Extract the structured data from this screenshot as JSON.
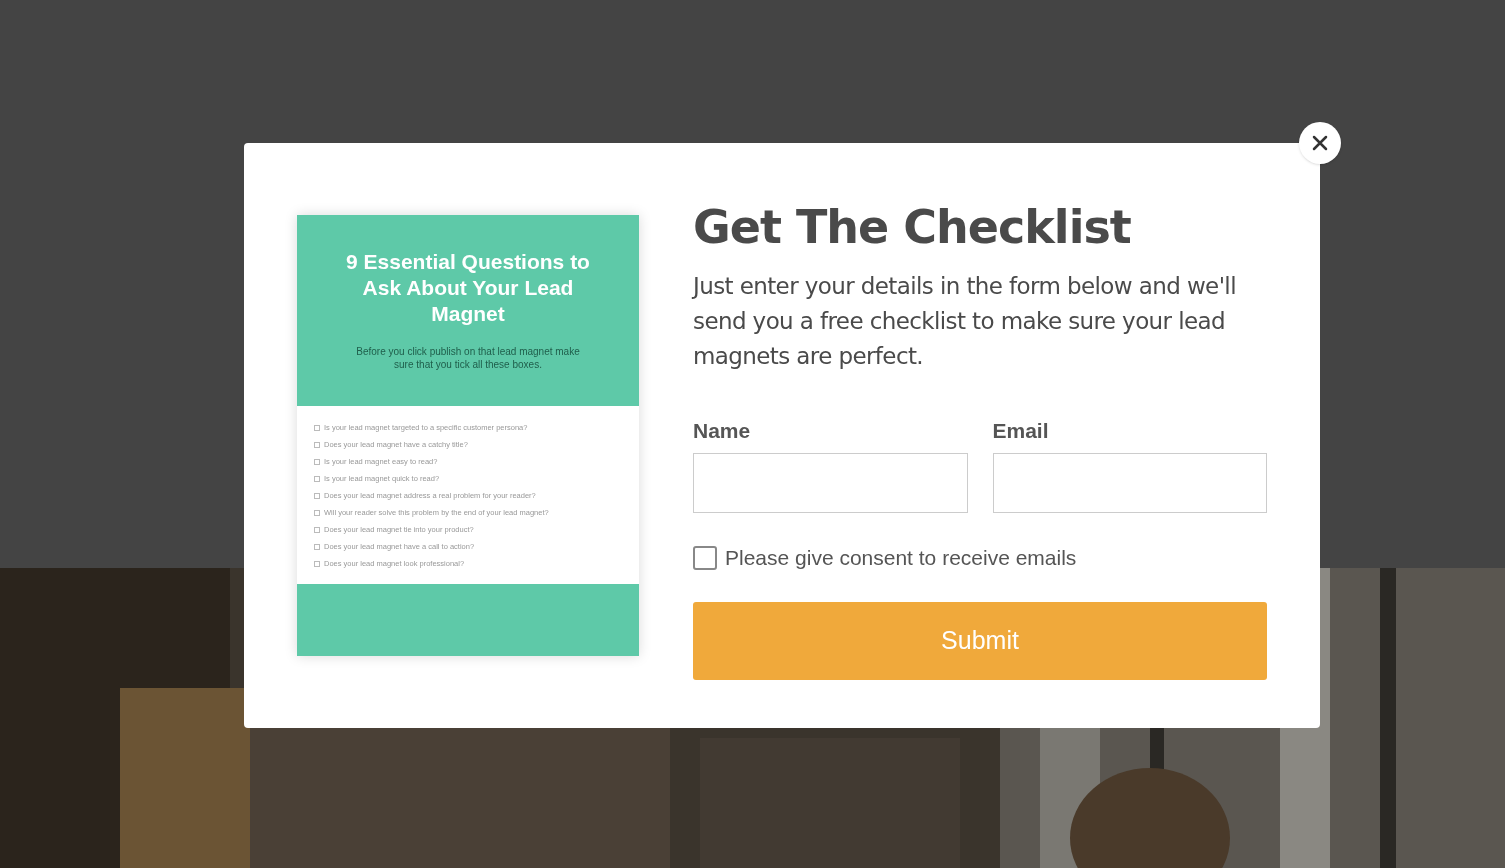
{
  "modal": {
    "cover": {
      "title": "9 Essential Questions to Ask About Your Lead Magnet",
      "subtitle": "Before you click publish on that lead magnet make sure that you tick all these boxes.",
      "items": [
        {
          "text": "Is your lead magnet targeted to a specific customer persona?",
          "checked": false
        },
        {
          "text": "Does your lead magnet have a catchy title?",
          "checked": false
        },
        {
          "text": "Is your lead magnet easy to read?",
          "checked": false
        },
        {
          "text": "Is your lead magnet quick to read?",
          "checked": false
        },
        {
          "text": "Does your lead magnet address a real problem for your reader?",
          "checked": false
        },
        {
          "text": "Will your reader solve this problem by the end of your lead magnet?",
          "checked": false
        },
        {
          "text": "Does your lead magnet tie into your product?",
          "checked": false
        },
        {
          "text": "Does your lead magnet have a call to action?",
          "checked": false
        },
        {
          "text": "Does your lead magnet look professional?",
          "checked": false
        }
      ]
    },
    "title": "Get The Checklist",
    "description": "Just enter your details in the form below and we'll send you a free checklist to make sure your lead magnets are perfect.",
    "fields": [
      {
        "label": "Name"
      },
      {
        "label": "Email"
      }
    ],
    "consent": {
      "label": "Please give consent to receive emails",
      "checked": false
    },
    "submit": "Submit"
  }
}
